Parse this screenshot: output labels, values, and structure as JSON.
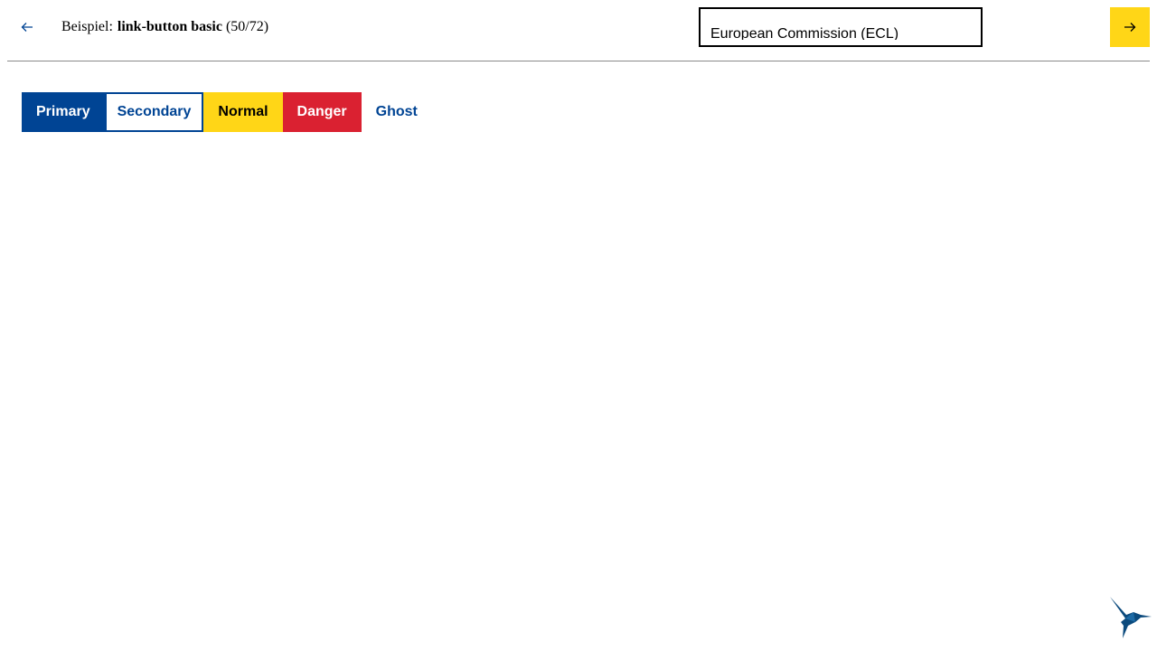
{
  "header": {
    "back_icon": "arrow-left-icon",
    "title_prefix": "Beispiel:",
    "title_name": "link-button basic",
    "title_counter": "(50/72)",
    "theme_select_value": "European Commission (ECL)",
    "next_icon": "arrow-right-icon"
  },
  "buttons": [
    {
      "label": "Primary",
      "variant": "primary"
    },
    {
      "label": "Secondary",
      "variant": "secondary"
    },
    {
      "label": "Normal",
      "variant": "normal"
    },
    {
      "label": "Danger",
      "variant": "danger"
    },
    {
      "label": "Ghost",
      "variant": "ghost"
    }
  ],
  "logo_icon": "hummingbird-logo-icon",
  "colors": {
    "primary": "#004494",
    "accent_yellow": "#ffd617",
    "danger": "#da2131",
    "divider": "#8a8a8a"
  }
}
